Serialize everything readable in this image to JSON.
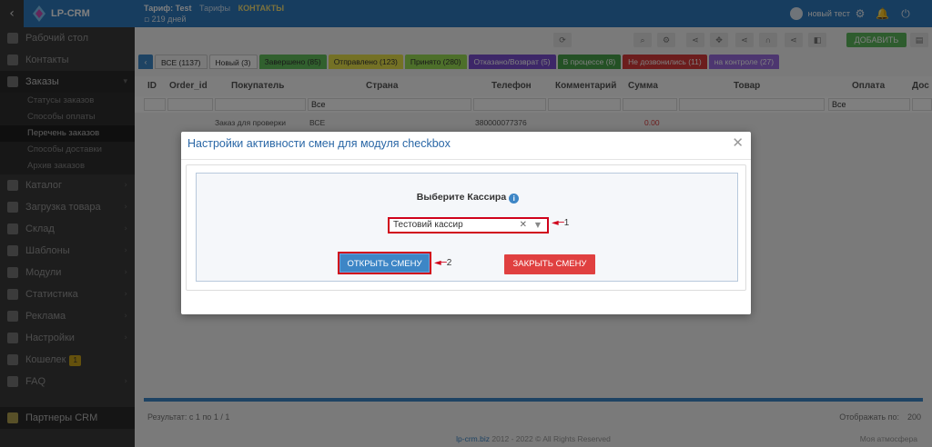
{
  "topbar": {
    "brand": "LP-CRM",
    "tariff_line": "Тариф: Test",
    "tariff_link1": "Тарифы",
    "tariff_link2": "КОНТАКТЫ",
    "days_left": "219 дней",
    "user_name": "новый тест"
  },
  "sidebar": {
    "items": [
      {
        "label": "Рабочий стол"
      },
      {
        "label": "Контакты"
      },
      {
        "label": "Заказы"
      },
      {
        "label": "Каталог"
      },
      {
        "label": "Загрузка товара"
      },
      {
        "label": "Склад"
      },
      {
        "label": "Шаблоны"
      },
      {
        "label": "Модули"
      },
      {
        "label": "Статистика"
      },
      {
        "label": "Реклама"
      },
      {
        "label": "Настройки"
      },
      {
        "label": "Кошелек",
        "badge": "1"
      },
      {
        "label": "FAQ"
      }
    ],
    "orders_sub": [
      "Статусы заказов",
      "Способы оплаты",
      "Перечень заказов",
      "Способы доставки",
      "Архив заказов"
    ],
    "partners": "Партнеры CRM"
  },
  "main": {
    "add_button": "ДОБАВИТЬ",
    "tabs": [
      {
        "label": "ВСЕ (1137)",
        "color": "#f4f4f4"
      },
      {
        "label": "Новый (3)",
        "color": "#ffffff"
      },
      {
        "label": "Завершено (85)",
        "color": "#63c15c"
      },
      {
        "label": "Отправлено (123)",
        "color": "#e9e34b"
      },
      {
        "label": "Принято (280)",
        "color": "#9adf55"
      },
      {
        "label": "Отказано/Возврат (5)",
        "color": "#7b4fd0"
      },
      {
        "label": "В процессе (8)",
        "color": "#48a24a"
      },
      {
        "label": "Не дозвонились (11)",
        "color": "#d93b3b"
      },
      {
        "label": "на контроле (27)",
        "color": "#9a6de0"
      }
    ],
    "columns": [
      "ID",
      "Order_id",
      "Покупатель",
      "Страна",
      "Телефон",
      "Комментарий",
      "Сумма",
      "Товар",
      "Оплата",
      "Дос"
    ],
    "filter_all": "Все",
    "row": {
      "client": "Заказ для проверки",
      "country": "ВСЕ",
      "phone": "380000077376",
      "sum": "0.00"
    },
    "pager": "Результат: с 1 по 1 / 1",
    "show_label": "Отображать по:",
    "show_value": "200",
    "copyright_link": "lp-crm.biz",
    "copyright_text": "2012 - 2022 © All Rights Reserved",
    "lang": "Моя атмосфера"
  },
  "modal": {
    "title": "Настройки активности смен для модуля checkbox",
    "cashier_label": "Выберите Кассира",
    "cashier_value": "Тестовий кассир",
    "open_button": "ОТКРЫТЬ СМЕНУ",
    "close_button": "ЗАКРЫТЬ СМЕНУ",
    "annotation_1": "1",
    "annotation_2": "2"
  }
}
